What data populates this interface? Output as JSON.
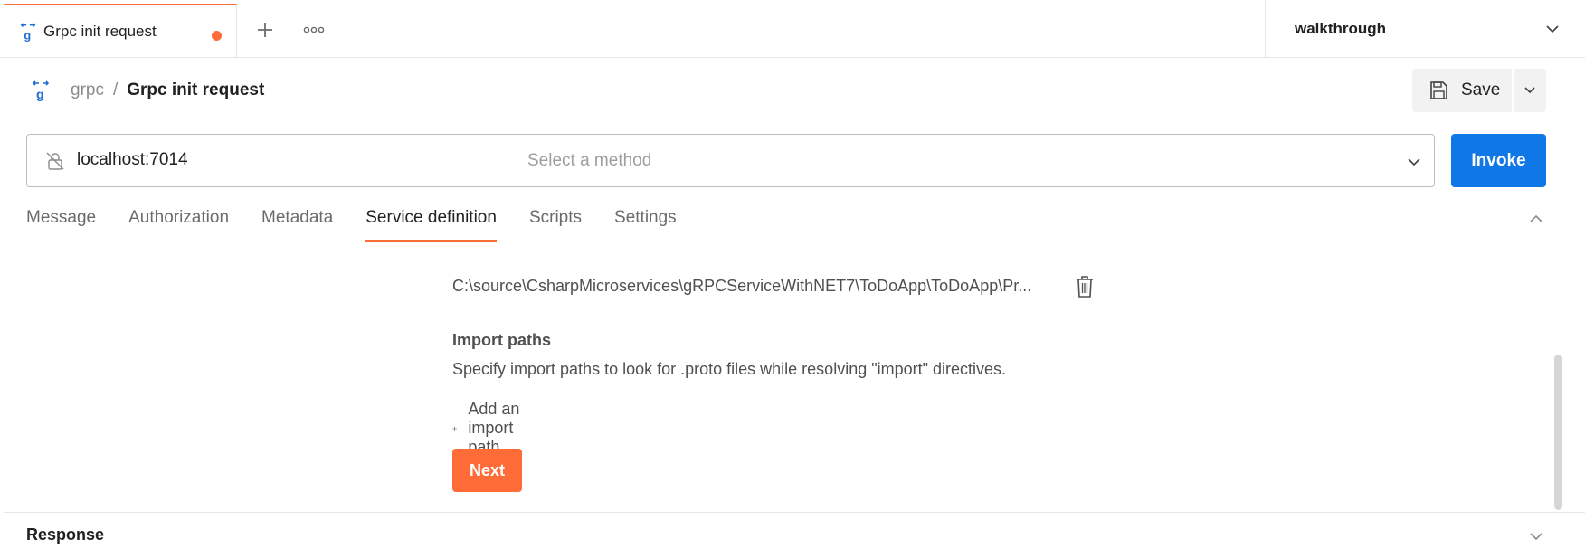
{
  "tab": {
    "title": "Grpc init request",
    "unsaved": true
  },
  "tab_actions": {
    "new_tab": "+",
    "more": "ooo"
  },
  "environment": {
    "name": "walkthrough"
  },
  "breadcrumb": {
    "parent": "grpc",
    "separator": "/",
    "current": "Grpc init request"
  },
  "toolbar": {
    "save_label": "Save"
  },
  "request": {
    "url": "localhost:7014",
    "method_placeholder": "Select a method",
    "invoke_label": "Invoke"
  },
  "tabs": [
    {
      "label": "Message",
      "active": false
    },
    {
      "label": "Authorization",
      "active": false
    },
    {
      "label": "Metadata",
      "active": false
    },
    {
      "label": "Service definition",
      "active": true
    },
    {
      "label": "Scripts",
      "active": false
    },
    {
      "label": "Settings",
      "active": false
    }
  ],
  "service_definition": {
    "proto_path": "C:\\source\\CsharpMicroservices\\gRPCServiceWithNET7\\ToDoApp\\ToDoApp\\Pr...",
    "import_heading": "Import paths",
    "import_description": "Specify import paths to look for .proto files while resolving \"import\" directives.",
    "add_import_label": "Add an import path",
    "next_label": "Next"
  },
  "response": {
    "title": "Response"
  },
  "colors": {
    "accent": "#ff6c37",
    "primary": "#0f77e6",
    "grpc_icon": "#1f6fd1"
  }
}
